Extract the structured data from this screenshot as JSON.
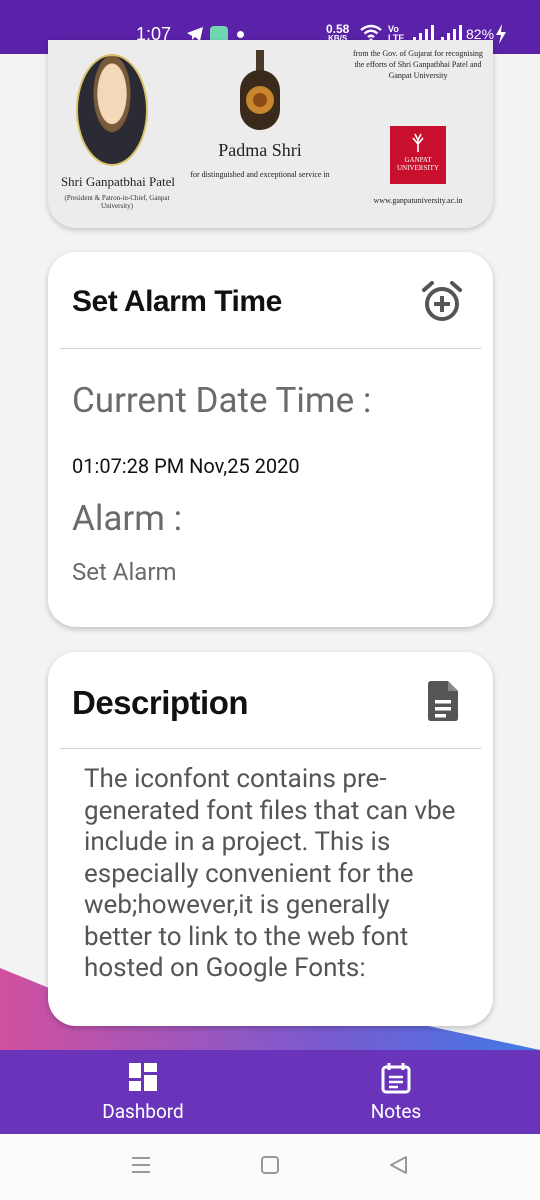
{
  "status_bar": {
    "time": "1:07",
    "net_speed": "0.58",
    "net_unit": "KB/S",
    "volte": "Vo LTE",
    "battery": "82%"
  },
  "banner": {
    "top_text": "from the Gov. of Gujarat for recognising the efforts of Shri Ganpatbhai Patel and Ganpat University",
    "person_name": "Shri Ganpatbhai Patel",
    "person_role": "(President & Patron-in-Chief, Ganpat University)",
    "award": "Padma Shri",
    "award_sub": "for distinguished and exceptional service in",
    "university": "GANPAT UNIVERSITY",
    "url": "www.ganpatuniversity.ac.in"
  },
  "alarm_card": {
    "title": "Set Alarm Time",
    "add_icon": "alarm-add-icon",
    "current_label": "Current Date Time :",
    "current_value": "01:07:28 PM Nov,25 2020",
    "alarm_label": "Alarm :",
    "alarm_value": "Set Alarm"
  },
  "description_card": {
    "title": "Description",
    "icon": "document-icon",
    "text": "The iconfont contains pre-generated font files that can vbe include in a project. This is especially convenient for the web;however,it is generally better to link to the web font hosted on Google Fonts:"
  },
  "bottom_nav": {
    "items": [
      {
        "label": "Dashbord",
        "icon": "dashboard-icon"
      },
      {
        "label": "Notes",
        "icon": "notes-icon"
      }
    ]
  },
  "colors": {
    "status_bar": "#5a22a8",
    "bottom_nav": "#6a34ba",
    "background": "#f3f3f3",
    "card": "#ffffff"
  }
}
